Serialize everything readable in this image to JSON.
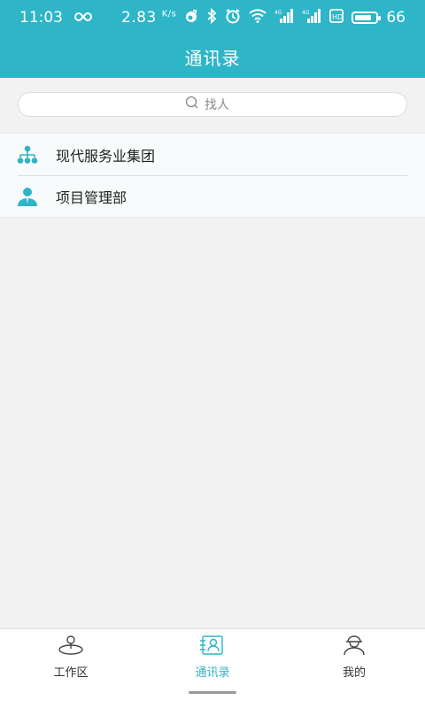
{
  "status_bar": {
    "time": "11:03",
    "speed": "2.83",
    "speed_unit": "K/s",
    "battery": "66",
    "icons": [
      "infinity-icon",
      "tiktok-icon",
      "bluetooth-icon",
      "alarm-icon",
      "wifi-icon",
      "signal-4g-icon",
      "signal-4g-icon",
      "hd-icon",
      "battery-icon"
    ]
  },
  "header": {
    "title": "通讯录"
  },
  "search": {
    "placeholder": "找人"
  },
  "contacts": {
    "items": [
      {
        "label": "现代服务业集团",
        "icon": "org-tree-icon"
      },
      {
        "label": "项目管理部",
        "icon": "person-icon"
      }
    ]
  },
  "bottom_nav": {
    "tabs": [
      {
        "label": "工作区",
        "icon": "location-pin-icon",
        "active": false
      },
      {
        "label": "通讯录",
        "icon": "contacts-card-icon",
        "active": true
      },
      {
        "label": "我的",
        "icon": "user-profile-icon",
        "active": false
      }
    ]
  },
  "colors": {
    "primary": "#2eb5c7",
    "background": "#f2f2f2"
  }
}
